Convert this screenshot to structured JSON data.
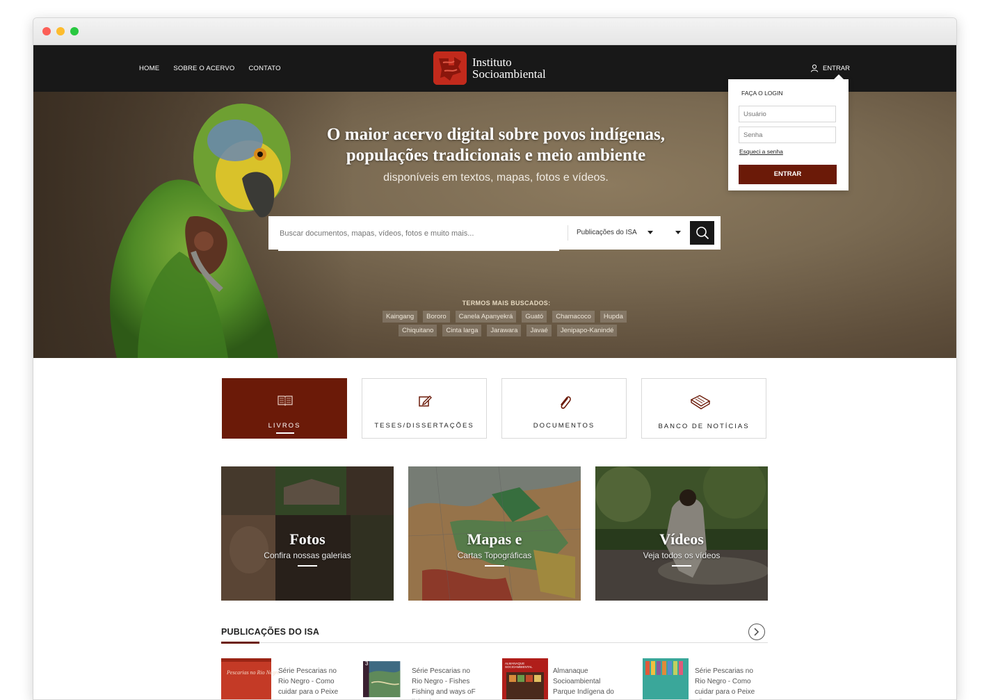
{
  "nav": {
    "links": [
      "HOME",
      "SOBRE O ACERVO",
      "CONTATO"
    ],
    "logo_line1": "Instituto",
    "logo_line2": "Socioambiental",
    "login_label": "ENTRAR"
  },
  "hero": {
    "title_line1": "O maior acervo digital sobre povos indígenas,",
    "title_line2": "populações tradicionais e meio ambiente",
    "subtitle": "disponíveis em textos, mapas, fotos e vídeos."
  },
  "search": {
    "placeholder": "Buscar documentos, mapas, vídeos, fotos e muito mais...",
    "selected": "Publicações do ISA"
  },
  "terms": {
    "label": "TERMOS MAIS BUSCADOS:",
    "row1": [
      "Kaingang",
      "Bororo",
      "Canela Apanyekrá",
      "Guató",
      "Chamacoco",
      "Hupda"
    ],
    "row2": [
      "Chiquitano",
      "Cinta larga",
      "Jarawara",
      "Javaé",
      "Jenipapo-Kanindé"
    ]
  },
  "login": {
    "title": "FAÇA O LOGIN",
    "user_placeholder": "Usuário",
    "pass_placeholder": "Senha",
    "forgot": "Esqueci a senha",
    "button": "ENTRAR"
  },
  "categories": [
    {
      "label": "LIVROS",
      "icon": "book-icon",
      "active": true
    },
    {
      "label": "TESES/DISSERTAÇÕES",
      "icon": "edit-icon",
      "active": false
    },
    {
      "label": "DOCUMENTOS",
      "icon": "paperclip-icon",
      "active": false
    },
    {
      "label": "BANCO DE NOTÍCIAS",
      "icon": "newspaper-icon",
      "active": false
    }
  ],
  "tiles": [
    {
      "title": "Fotos",
      "subtitle": "Confira nossas galerias"
    },
    {
      "title": "Mapas e",
      "subtitle": "Cartas Topográficas"
    },
    {
      "title": "Vídeos",
      "subtitle": "Veja todos os vídeos"
    }
  ],
  "publications": {
    "heading": "PUBLICAÇÕES DO ISA",
    "items": [
      {
        "title": "Série Pescarias no Rio Negro - Como cuidar para o Peixe",
        "cover_text": "Pescarias no Rio Negro"
      },
      {
        "title": "Série Pescarias no Rio Negro - Fishes Fishing and ways oF living in",
        "cover_text": "3"
      },
      {
        "title": "Almanaque Socioambiental Parque Indígena do",
        "cover_text": "ALMANAQUE SOCIOAMBIENTAL"
      },
      {
        "title": "Série Pescarias no Rio Negro - Como cuidar para o Peixe não",
        "cover_text": ""
      }
    ]
  },
  "colors": {
    "brand": "#6b1a08",
    "logo_red": "#c22a1c",
    "nav_bg": "#181818"
  }
}
